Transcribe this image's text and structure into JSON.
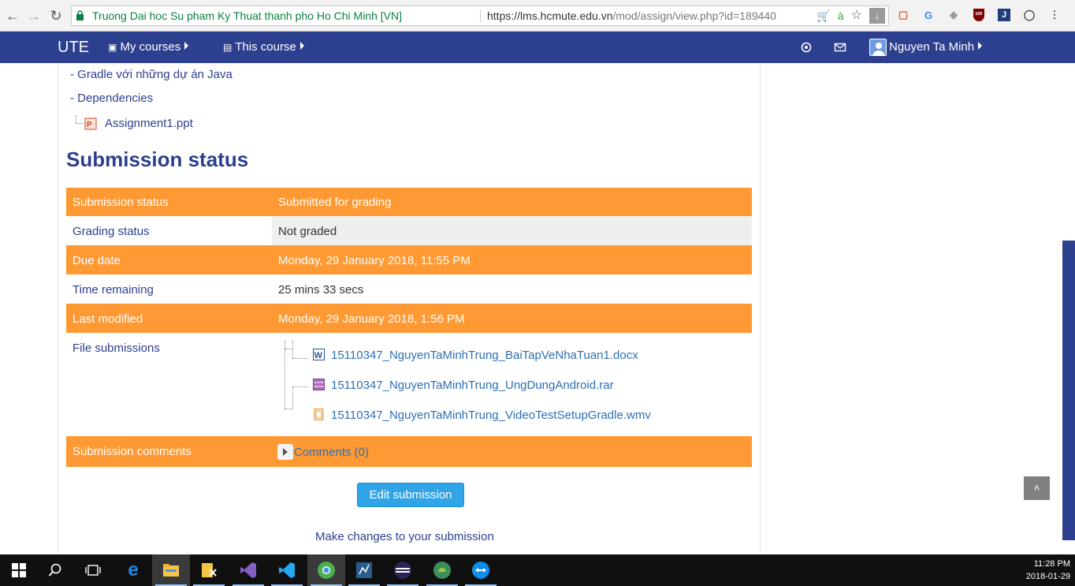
{
  "browser": {
    "site_name": "Truong Dai hoc Su pham Ky Thuat thanh pho Ho Chi Minh [VN]",
    "url_host": "https://lms.hcmute.edu.vn",
    "url_path": "/mod/assign/view.php?id=189440"
  },
  "navbar": {
    "brand": "UTE",
    "my_courses": "My courses",
    "this_course": "This course",
    "user_name": "Nguyen Ta Minh"
  },
  "tree": {
    "item1": "- Gradle với những dự án Java",
    "item2": "- Dependencies",
    "file": "Assignment1.ppt"
  },
  "heading": "Submission status",
  "status_table": {
    "submission_status": {
      "label": "Submission status",
      "value": "Submitted for grading"
    },
    "grading_status": {
      "label": "Grading status",
      "value": "Not graded"
    },
    "due_date": {
      "label": "Due date",
      "value": "Monday, 29 January 2018, 11:55 PM"
    },
    "time_remaining": {
      "label": "Time remaining",
      "value": "25 mins 33 secs"
    },
    "last_modified": {
      "label": "Last modified",
      "value": "Monday, 29 January 2018, 1:56 PM"
    },
    "file_submissions": {
      "label": "File submissions",
      "files": [
        "15110347_NguyenTaMinhTrung_BaiTapVeNhaTuan1.docx",
        "15110347_NguyenTaMinhTrung_UngDungAndroid.rar",
        "15110347_NguyenTaMinhTrung_VideoTestSetupGradle.wmv"
      ]
    },
    "submission_comments": {
      "label": "Submission comments",
      "value": "Comments (0)"
    }
  },
  "edit_button": "Edit submission",
  "help_text": "Make changes to your submission",
  "clock": {
    "time": "11:28 PM",
    "date": "2018-01-29"
  },
  "colors": {
    "navbar": "#2d3f8f",
    "orange_row": "#ff9933",
    "button": "#2fa4e7"
  }
}
